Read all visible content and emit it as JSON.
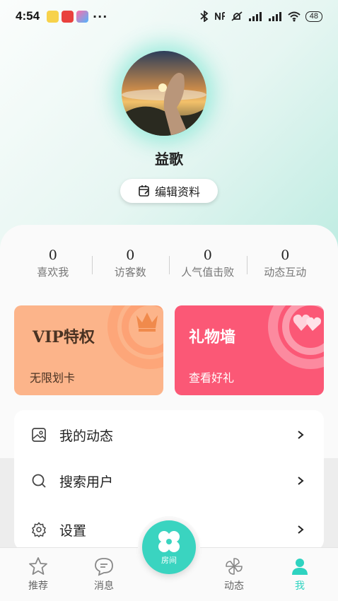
{
  "status_bar": {
    "time": "4:54",
    "more": "···",
    "battery": "48"
  },
  "profile": {
    "username": "益歌",
    "edit_label": "编辑资料"
  },
  "stats": [
    {
      "value": "0",
      "label": "喜欢我"
    },
    {
      "value": "0",
      "label": "访客数"
    },
    {
      "value": "0",
      "label": "人气值击败"
    },
    {
      "value": "0",
      "label": "动态互动"
    }
  ],
  "promos": {
    "vip": {
      "title": "VIP特权",
      "subtitle": "无限划卡",
      "color": "#fcb48a"
    },
    "gift": {
      "title": "礼物墙",
      "subtitle": "查看好礼",
      "color": "#fb5876"
    }
  },
  "menu": [
    {
      "label": "我的动态",
      "icon": "image-icon"
    },
    {
      "label": "搜索用户",
      "icon": "search-icon"
    },
    {
      "label": "设置",
      "icon": "gear-icon"
    }
  ],
  "nav": {
    "recommend": "推荐",
    "messages": "消息",
    "room": "房间",
    "moments": "动态",
    "me": "我"
  },
  "colors": {
    "accent": "#2ed3c0"
  }
}
